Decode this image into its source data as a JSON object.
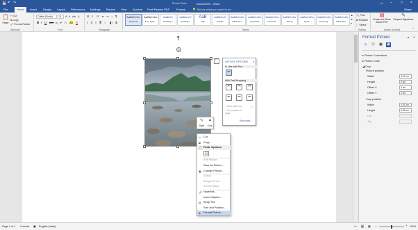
{
  "title_bar": {
    "contextual_group": "Picture Tools",
    "document_title": "Document1 - Word",
    "user": "Sign in"
  },
  "tabs": [
    "File",
    "Home",
    "Insert",
    "Design",
    "Layout",
    "References",
    "Mailings",
    "Review",
    "View",
    "Acrobat",
    "Foxit Reader PDF",
    "Format"
  ],
  "tell_me": "Tell me what you want to do...",
  "share": "Share",
  "ribbon": {
    "paste": "Paste",
    "cut": "Cut",
    "copy": "Copy",
    "format_painter": "Format Painter",
    "font_name": "Calibri (Body)",
    "font_size": "11",
    "styles": [
      {
        "sample": "AaBbCcDc",
        "name": "¶ Normal"
      },
      {
        "sample": "AaBbCcDc",
        "name": "¶ No Spac..."
      },
      {
        "sample": "AaBbCc",
        "name": "Heading 1"
      },
      {
        "sample": "AaBbCcC",
        "name": "Heading 2"
      },
      {
        "sample": "AaB",
        "name": "Title"
      },
      {
        "sample": "AaBbCcC",
        "name": "Subtitle"
      },
      {
        "sample": "AaBbCcDc",
        "name": "Subtle Em..."
      },
      {
        "sample": "AaBbCcDc",
        "name": "Emphasis"
      },
      {
        "sample": "AaBbCcDc",
        "name": "Intense E..."
      },
      {
        "sample": "AaBbCcDc",
        "name": "Strong"
      },
      {
        "sample": "AaBbCcDc",
        "name": "Quote"
      },
      {
        "sample": "AaBbCcDc",
        "name": "Intense Q..."
      },
      {
        "sample": "AaBbCcDc",
        "name": "Subtle Ref..."
      }
    ],
    "find": "Find",
    "replace": "Replace",
    "select": "Select",
    "acrobat_create": "Create and Share Adobe PDF",
    "acrobat_request": "Request Signatures",
    "groups": {
      "clipboard": "Clipboard",
      "font": "Font",
      "paragraph": "Paragraph",
      "styles": "Styles",
      "editing": "Editing",
      "adobe": "Adobe Acrobat"
    }
  },
  "document": {
    "pilcrow": "¶"
  },
  "mini_toolbar": {
    "style": "Style",
    "crop": "Crop"
  },
  "layout_options": {
    "title": "LAYOUT OPTIONS",
    "inline_heading": "In Line with Text",
    "wrapping_heading": "With Text Wrapping",
    "move_with_text": "Move with text",
    "fix_position": "Fix position on page",
    "see_more": "See more..."
  },
  "context_menu": {
    "items": [
      {
        "label": "Cut",
        "icon": "✂",
        "disabled": false
      },
      {
        "label": "Copy",
        "icon": "⧉",
        "disabled": false
      },
      {
        "label": "Paste Options:",
        "icon": "📋",
        "disabled": false,
        "header": true
      },
      {
        "label": "",
        "icon": "📋",
        "disabled": false,
        "paste_icon": true
      },
      {
        "label": "Edit Picture",
        "icon": "",
        "disabled": true
      },
      {
        "label": "Save as Picture...",
        "icon": "",
        "disabled": false
      },
      {
        "label": "Change Picture...",
        "icon": "▣",
        "disabled": false
      },
      {
        "label": "Group",
        "icon": "",
        "disabled": true
      },
      {
        "label": "Bring to Front",
        "icon": "",
        "disabled": true
      },
      {
        "label": "Send to Back",
        "icon": "",
        "disabled": true
      },
      {
        "label": "Hyperlink...",
        "icon": "🔗",
        "disabled": false
      },
      {
        "label": "Insert Caption...",
        "icon": "",
        "disabled": false
      },
      {
        "label": "Wrap Text",
        "icon": "▤",
        "disabled": false
      },
      {
        "label": "Size and Position...",
        "icon": "",
        "disabled": false
      },
      {
        "label": "Format Picture...",
        "icon": "◈",
        "disabled": false,
        "highlighted": true
      }
    ]
  },
  "format_pane": {
    "title": "Format Picture",
    "sections": {
      "corrections": "Picture Corrections",
      "color": "Picture Color",
      "crop": "Crop"
    },
    "picture_position": "Picture position",
    "width_label": "Width",
    "width_value": "4.67 cm",
    "height_label": "Height",
    "height_value": "6 cm",
    "offset_x_label": "Offset X",
    "offset_x_value": "0 cm",
    "offset_y_label": "Offset Y",
    "offset_y_value": "0 cm",
    "crop_position": "Crop position",
    "crop_width_label": "Width",
    "crop_width_value": "4.67 cm",
    "crop_height_label": "Height",
    "crop_height_value": "5.95 cm",
    "left_label": "Left",
    "top_label": "Top"
  },
  "status": {
    "page": "Page 1 of 1",
    "words": "0 words",
    "language": "English (India)",
    "zoom": "100%"
  },
  "colors": {
    "accent": "#2b579a",
    "ribbon_bg": "#f3f3f3",
    "canvas_bg": "#e6e6e6"
  }
}
